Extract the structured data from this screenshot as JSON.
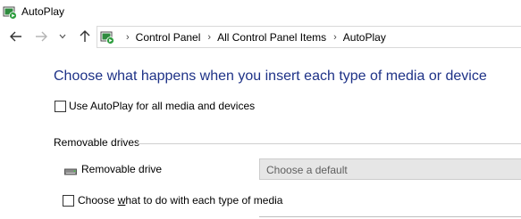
{
  "window": {
    "title": "AutoPlay",
    "app_icon": "autoplay-icon"
  },
  "nav": {
    "back_icon": "back-arrow-icon",
    "forward_icon": "forward-arrow-icon",
    "recent_icon": "chevron-down-icon",
    "up_icon": "up-arrow-icon"
  },
  "address": {
    "icon": "autoplay-icon",
    "breadcrumbs": [
      "Control Panel",
      "All Control Panel Items",
      "AutoPlay"
    ]
  },
  "content": {
    "heading": "Choose what happens when you insert each type of media or device",
    "use_autoplay": {
      "label": "Use AutoPlay for all media and devices",
      "checked": false
    },
    "removable_section": {
      "title": "Removable drives",
      "drive_label": "Removable drive",
      "drive_icon": "removable-drive-icon",
      "drive_select_value": "Choose a default"
    },
    "each_type": {
      "label_pre": "Choose ",
      "label_mnemonic": "w",
      "label_post": "hat to do with each type of media",
      "checked": false
    }
  },
  "colors": {
    "heading": "#1e3287",
    "select_bg": "#e6e6e6",
    "select_text": "#5f5f5f"
  }
}
